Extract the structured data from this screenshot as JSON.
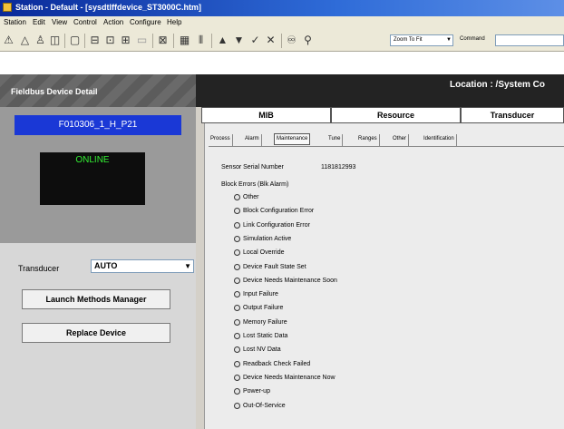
{
  "window": {
    "title": "Station - Default - [sysdtlffdevice_ST3000C.htm]"
  },
  "menu": [
    "Station",
    "Edit",
    "View",
    "Control",
    "Action",
    "Configure",
    "Help"
  ],
  "toolbar": {
    "zoom": "Zoom To Fit",
    "command_label": "Command"
  },
  "header": {
    "title": "Fieldbus Device Detail",
    "location": "Location : /System Co"
  },
  "device": {
    "name": "F010306_1_H_P21",
    "status": "ONLINE",
    "block_label": "Transducer",
    "mode": "AUTO",
    "launch_button": "Launch Methods Manager",
    "replace_button": "Replace Device"
  },
  "main_tabs": [
    "MIB",
    "Resource",
    "Transducer"
  ],
  "sub_tabs": [
    "Process",
    "Alarm",
    "Maintenance",
    "Tune",
    "Ranges",
    "Other",
    "Identification"
  ],
  "maintenance": {
    "serial_label": "Sensor Serial Number",
    "serial_value": "1181812993",
    "block_errors_label": "Block Errors (Blk Alarm)",
    "errors": [
      "Other",
      "Block Configuration Error",
      "Link Configuration Error",
      "Simulation Active",
      "Local Override",
      "Device Fault State Set",
      "Device Needs Maintenance Soon",
      "Input Failure",
      "Output Failure",
      "Memory Failure",
      "Lost Static Data",
      "Lost NV Data",
      "Readback Check Failed",
      "Device Needs Maintenance Now",
      "Power-up",
      "Out-Of-Service"
    ]
  },
  "colors": {
    "title_bar": "#0a2a9a",
    "device_name_bg": "#1a38d6",
    "status_text": "#33ee33"
  }
}
